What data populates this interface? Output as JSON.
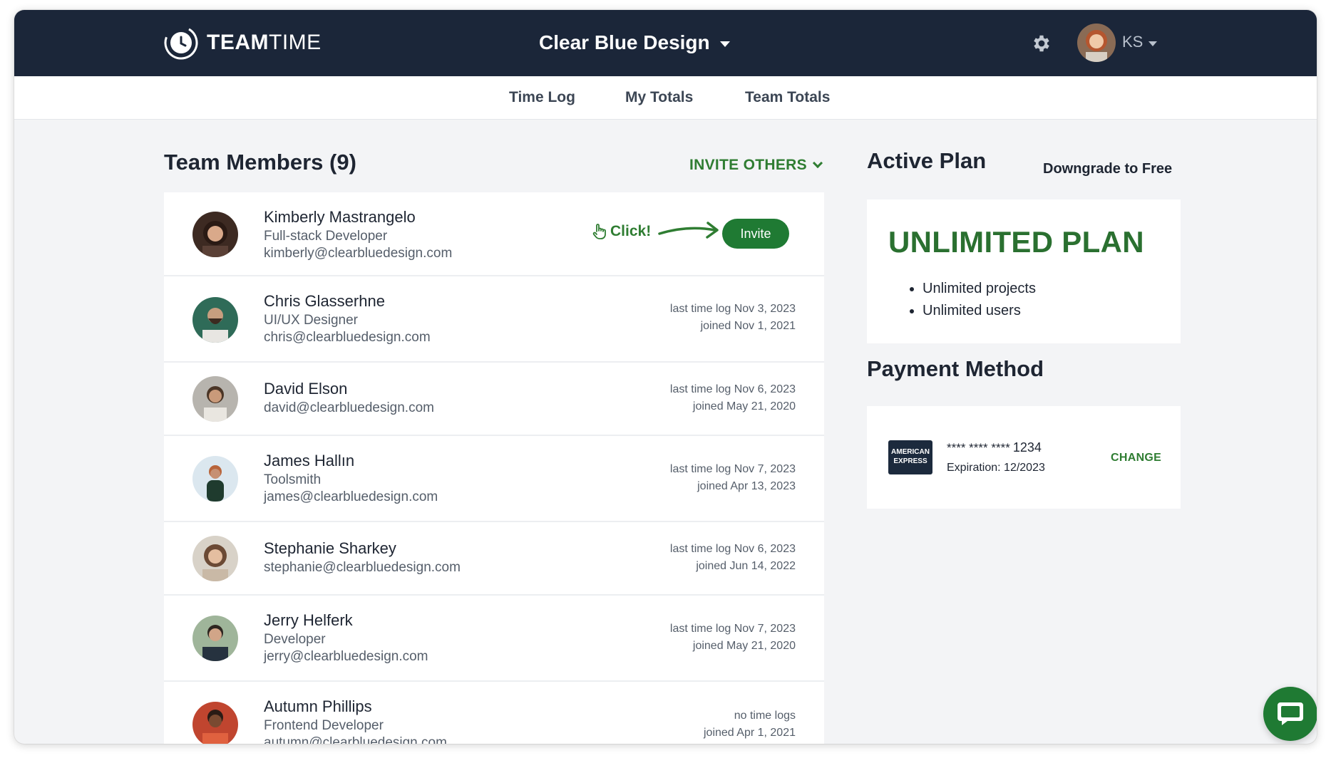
{
  "app": {
    "logo_bold": "TEAM",
    "logo_light": "TIME",
    "workspace": "Clear Blue Design",
    "user_initials": "KS"
  },
  "nav": {
    "tabs": [
      {
        "label": "Time Log"
      },
      {
        "label": "My Totals"
      },
      {
        "label": "Team Totals"
      }
    ]
  },
  "team": {
    "title": "Team Members (9)",
    "invite_others": "INVITE OTHERS",
    "click_hint": "Click!",
    "invite_label": "Invite",
    "members": [
      {
        "name": "Kimberly Mastrangelo",
        "role": "Full-stack Developer",
        "email": "kimberly@clearbluedesign.com",
        "last_log": "",
        "joined": ""
      },
      {
        "name": "Chris Glasserhne",
        "role": "UI/UX Designer",
        "email": "chris@clearbluedesign.com",
        "last_log": "last time log Nov 3, 2023",
        "joined": "joined Nov 1, 2021"
      },
      {
        "name": "David Elson",
        "role": "",
        "email": "david@clearbluedesign.com",
        "last_log": "last time log Nov 6, 2023",
        "joined": "joined May 21, 2020"
      },
      {
        "name": "James Hallın",
        "role": "Toolsmith",
        "email": "james@clearbluedesign.com",
        "last_log": "last time log Nov 7, 2023",
        "joined": "joined Apr 13, 2023"
      },
      {
        "name": "Stephanie Sharkey",
        "role": "",
        "email": "stephanie@clearbluedesign.com",
        "last_log": "last time log Nov 6, 2023",
        "joined": "joined Jun 14, 2022"
      },
      {
        "name": "Jerry Helferk",
        "role": "Developer",
        "email": "jerry@clearbluedesign.com",
        "last_log": "last time log Nov 7, 2023",
        "joined": "joined May 21, 2020"
      },
      {
        "name": "Autumn Phillips",
        "role": "Frontend Developer",
        "email": "autumn@clearbluedesign.com",
        "last_log": "no time logs",
        "joined": "joined Apr 1, 2021"
      }
    ]
  },
  "plan": {
    "title": "Active Plan",
    "downgrade": "Downgrade to Free",
    "name": "UNLIMITED PLAN",
    "features": [
      "Unlimited projects",
      "Unlimited users"
    ]
  },
  "payment": {
    "title": "Payment Method",
    "card_brand": "AMERICAN EXPRESS",
    "masked": "**** **** ****",
    "last4": "1234",
    "expiration": "Expiration: 12/2023",
    "change": "CHANGE"
  },
  "colors": {
    "header_bg": "#1b2639",
    "accent_green": "#2f7d32",
    "button_green": "#1f7a33",
    "page_bg": "#f3f4f6"
  }
}
